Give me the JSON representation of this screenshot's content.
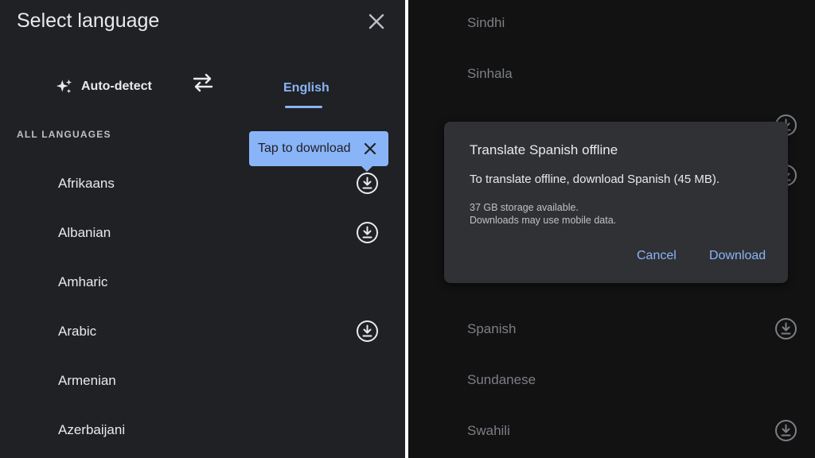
{
  "left": {
    "title": "Select language",
    "tabs": {
      "auto_detect": "Auto-detect",
      "target": "English"
    },
    "section_label": "ALL LANGUAGES",
    "tooltip": "Tap to download",
    "languages": [
      {
        "name": "Afrikaans",
        "download": true
      },
      {
        "name": "Albanian",
        "download": true
      },
      {
        "name": "Amharic",
        "download": false
      },
      {
        "name": "Arabic",
        "download": true
      },
      {
        "name": "Armenian",
        "download": false
      },
      {
        "name": "Azerbaijani",
        "download": false
      }
    ]
  },
  "right": {
    "languages": [
      {
        "name": "Sindhi",
        "download": false
      },
      {
        "name": "Sinhala",
        "download": false
      },
      {
        "name": "Spanish",
        "download": true
      },
      {
        "name": "Sundanese",
        "download": false
      },
      {
        "name": "Swahili",
        "download": true
      }
    ],
    "dialog": {
      "title": "Translate Spanish offline",
      "body": "To translate offline, download Spanish (45 MB).",
      "note_line1": "37 GB storage available.",
      "note_line2": "Downloads may use mobile data.",
      "cancel": "Cancel",
      "confirm": "Download"
    }
  },
  "colors": {
    "background": "#202124",
    "accent": "#8ab4f8",
    "dialog": "#303134"
  },
  "icons": [
    "close-icon",
    "sparkle-icon",
    "swap-icon",
    "download-icon"
  ]
}
